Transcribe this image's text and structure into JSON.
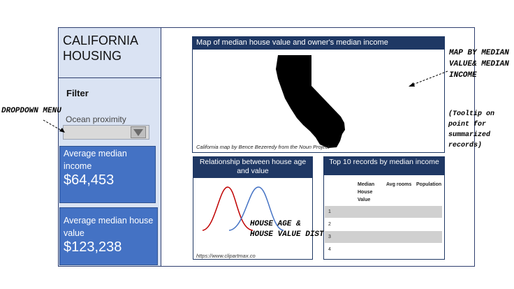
{
  "sidebar": {
    "title": "CALIFORNIA HOUSING",
    "filter_label": "Filter",
    "dropdown": {
      "label": "Ocean proximity",
      "value": ""
    }
  },
  "kpis": [
    {
      "label": "Average median income",
      "value": "$64,453"
    },
    {
      "label": "Average median house value",
      "value": "$123,238"
    }
  ],
  "map_panel": {
    "title": "Map of median house value and owner's median income",
    "credit": "California map by Bence Bezeredy from the Noun Project"
  },
  "dist_panel": {
    "title": "Relationship between house age and value",
    "credit": "https://www.clipartmax.co",
    "colors": {
      "left_curve": "#c00000",
      "right_curve": "#4472c4"
    }
  },
  "table_panel": {
    "title": "Top 10 records by median income",
    "columns": [
      "Median House Value",
      "Avg rooms",
      "Population"
    ],
    "rows": [
      "1",
      "2",
      "3",
      "4"
    ]
  },
  "annotations": {
    "dropdown": "DROPDOWN MENU",
    "map": "MAP BY MEDIAN VALUE& MEDIAN INCOME",
    "map_sub": "(Tooltip on point for summarized records)",
    "dist": "HOUSE AGE & HOUSE VALUE DIST"
  },
  "colors": {
    "brand_dark": "#1f3864",
    "kpi_blue": "#4472c4",
    "sidebar_bg": "#dae3f3"
  }
}
